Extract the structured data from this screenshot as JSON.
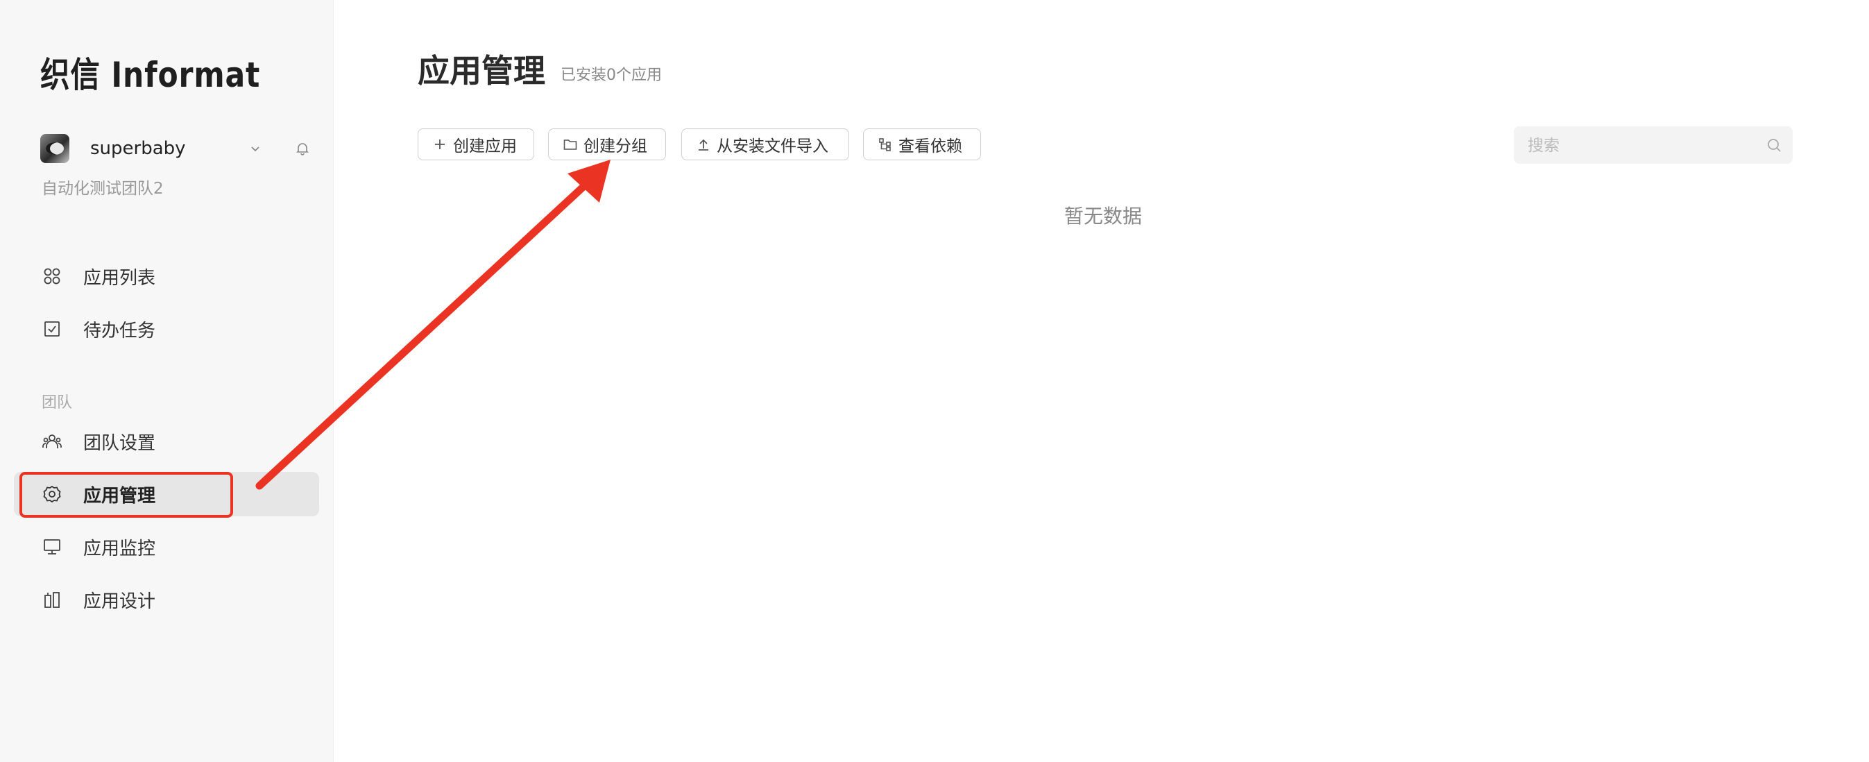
{
  "brand": {
    "name": "织信 Informat"
  },
  "user": {
    "name": "superbaby",
    "team": "自动化测试团队2"
  },
  "sidebar": {
    "items": [
      {
        "label": "应用列表",
        "icon": "apps-grid-icon"
      },
      {
        "label": "待办任务",
        "icon": "checkbox-icon"
      }
    ],
    "team_section_label": "团队",
    "team_items": [
      {
        "label": "团队设置",
        "icon": "team-users-icon"
      },
      {
        "label": "应用管理",
        "icon": "gear-icon",
        "active": true
      },
      {
        "label": "应用监控",
        "icon": "monitor-icon"
      },
      {
        "label": "应用设计",
        "icon": "design-icon"
      }
    ]
  },
  "header": {
    "title": "应用管理",
    "subtitle": "已安装0个应用"
  },
  "toolbar": {
    "create_app": "创建应用",
    "create_group": "创建分组",
    "import_from_file": "从安装文件导入",
    "view_dependencies": "查看依赖"
  },
  "search": {
    "placeholder": "搜索",
    "value": ""
  },
  "main": {
    "empty_text": "暂无数据"
  },
  "colors": {
    "annotation": "#ea3323",
    "active_bg": "#e6e6e6",
    "sidebar_bg": "#f7f7f7"
  }
}
